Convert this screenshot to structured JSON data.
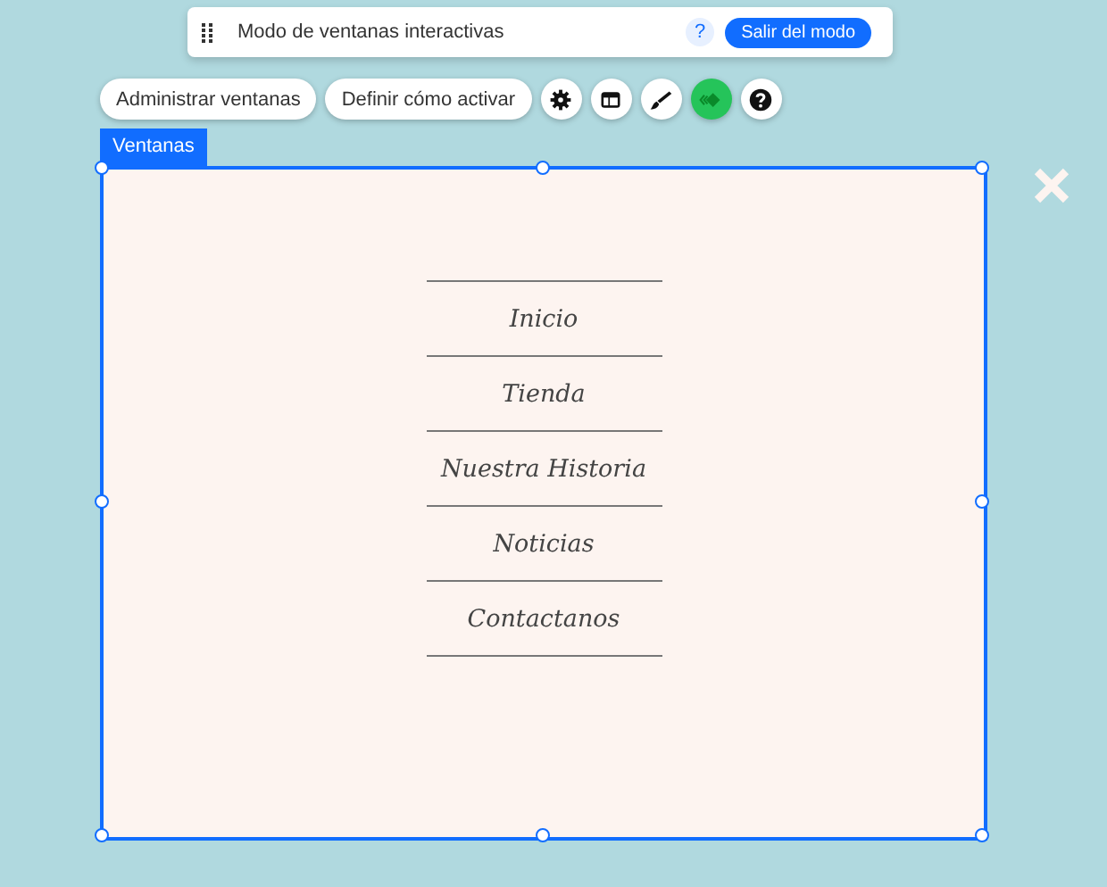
{
  "mode_bar": {
    "title": "Modo de ventanas interactivas",
    "help": "?",
    "exit_button": "Salir del modo"
  },
  "toolbar": {
    "buttons": [
      "Administrar ventanas",
      "Definir cómo activar"
    ],
    "icon_buttons": [
      {
        "kind": "settings"
      },
      {
        "kind": "layout"
      },
      {
        "kind": "brush"
      },
      {
        "kind": "animation"
      },
      {
        "kind": "help"
      }
    ]
  },
  "lightbox": {
    "tab": "Ventanas",
    "menu_items": [
      {
        "label": "Inicio"
      },
      {
        "label": "Tienda"
      },
      {
        "label": "Nuestra Historia"
      },
      {
        "label": "Noticias"
      },
      {
        "label": "Contactanos"
      }
    ]
  }
}
